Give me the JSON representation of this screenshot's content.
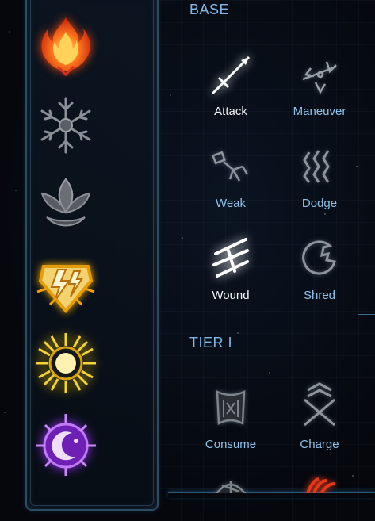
{
  "colors": {
    "section_title": "#7fb8e6",
    "label_active": "#f2f4f6",
    "label_inactive": "#8fc2ea",
    "panel_border": "#2c4c62"
  },
  "elements": [
    {
      "name": "fire",
      "icon": "flame-icon",
      "color": "#ff5a1f"
    },
    {
      "name": "frost",
      "icon": "snowflake-icon",
      "color": "#8a8f96"
    },
    {
      "name": "earth",
      "icon": "lotus-icon",
      "color": "#7d8187"
    },
    {
      "name": "lightning",
      "icon": "lightning-shield-icon",
      "color": "#f2b318"
    },
    {
      "name": "light",
      "icon": "sun-icon",
      "color": "#e5c21a"
    },
    {
      "name": "arcane",
      "icon": "crescent-star-icon",
      "color": "#a23cf0"
    }
  ],
  "sections": {
    "base": {
      "title": "BASE",
      "skills": [
        {
          "label": "Attack",
          "icon": "sword-icon",
          "active": true
        },
        {
          "label": "Maneuver",
          "icon": "maneuver-arrows-icon",
          "active": false
        },
        {
          "label": "Weak",
          "icon": "weak-figure-icon",
          "active": false
        },
        {
          "label": "Dodge",
          "icon": "dodge-waves-icon",
          "active": false
        },
        {
          "label": "Wound",
          "icon": "slash-marks-icon",
          "active": true
        },
        {
          "label": "Shred",
          "icon": "shred-circle-icon",
          "active": false
        }
      ]
    },
    "tier1": {
      "title": "TIER I",
      "skills": [
        {
          "label": "Consume",
          "icon": "consume-box-icon",
          "active": false
        },
        {
          "label": "Charge",
          "icon": "charge-arrows-icon",
          "active": false
        },
        {
          "icon": "helmet-icon",
          "active": false
        },
        {
          "icon": "fire-claw-icon",
          "active": false
        }
      ]
    }
  }
}
